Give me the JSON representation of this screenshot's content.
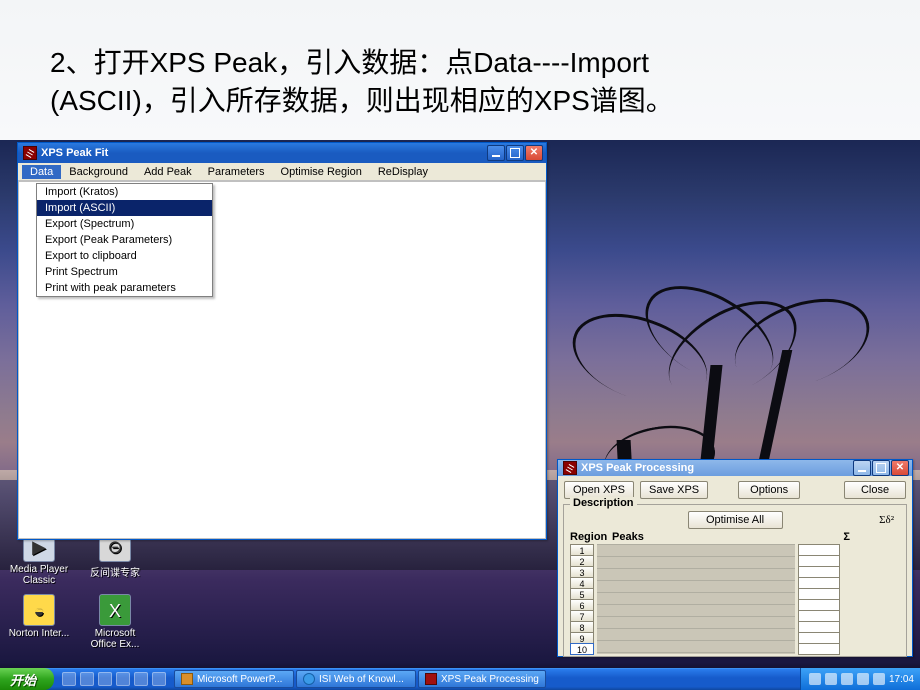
{
  "slide": {
    "line1": "2、打开XPS Peak，引入数据：点Data----Import",
    "line2": "(ASCII)，引入所存数据，则出现相应的XPS谱图。"
  },
  "xps_fit": {
    "title": "XPS Peak Fit",
    "menus": {
      "data": "Data",
      "background": "Background",
      "add_peak": "Add Peak",
      "parameters": "Parameters",
      "optimise_region": "Optimise Region",
      "redisplay": "ReDisplay"
    },
    "data_menu": {
      "import_kratos": "Import (Kratos)",
      "import_ascii": "Import (ASCII)",
      "export_spectrum": "Export (Spectrum)",
      "export_peak_parameters": "Export (Peak Parameters)",
      "export_clipboard": "Export to clipboard",
      "print_spectrum": "Print Spectrum",
      "print_peak_parameters": "Print with peak parameters"
    }
  },
  "xps_proc": {
    "title": "XPS Peak Processing",
    "buttons": {
      "open": "Open XPS",
      "save": "Save XPS",
      "options": "Options",
      "close": "Close",
      "optimise_all": "Optimise All"
    },
    "group_title": "Description",
    "headers": {
      "region": "Region",
      "peaks": "Peaks",
      "delta": "Σδ²",
      "sigma": "Σ"
    },
    "row_headers": [
      "1",
      "2",
      "3",
      "4",
      "5",
      "6",
      "7",
      "8",
      "9",
      "10"
    ]
  },
  "desktop_icons": {
    "mpc": "Media Player Classic",
    "fanxian": "反间谍专家",
    "norton": "Norton Inter...",
    "excel": "Microsoft Office Ex..."
  },
  "taskbar": {
    "start": "开始",
    "tasks": {
      "ppt": "Microsoft PowerP...",
      "isi": "ISI Web of Knowl...",
      "xps": "XPS Peak Processing"
    },
    "time": "17:04"
  }
}
